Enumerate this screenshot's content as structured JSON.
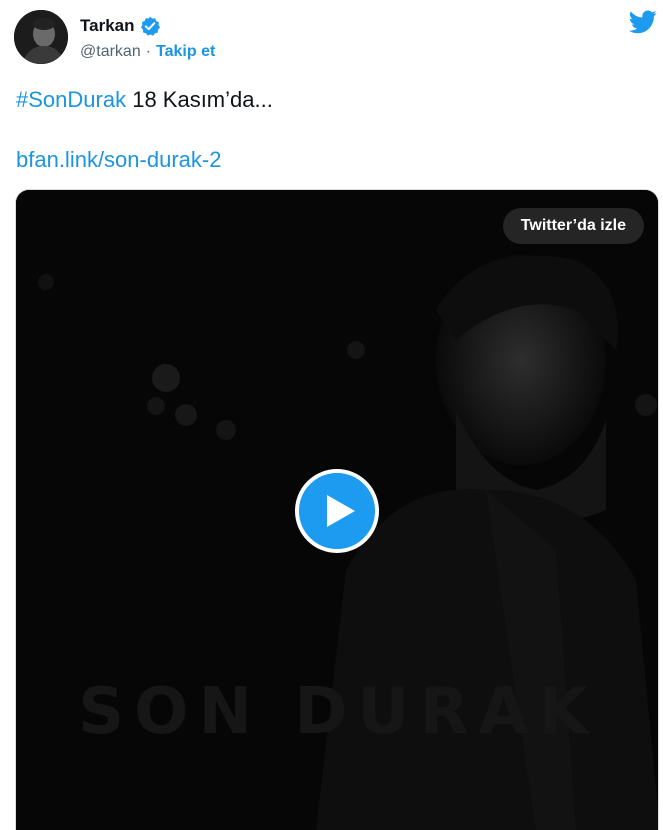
{
  "author": {
    "display_name": "Tarkan",
    "handle": "@tarkan",
    "separator": "·",
    "follow_label": "Takip et"
  },
  "tweet": {
    "hashtag": "#SonDurak",
    "text": "18 Kasım’da...",
    "link": "bfan.link/son-durak-2"
  },
  "media": {
    "watch_label": "Twitter’da izle",
    "cover_text": "SON DURAK"
  },
  "icons": {
    "verified": "verified-badge-icon",
    "brand": "twitter-bird-icon",
    "play": "play-icon"
  },
  "colors": {
    "link": "#1b95e0",
    "play_button": "#1d9bf0",
    "media_background": "#060606"
  }
}
